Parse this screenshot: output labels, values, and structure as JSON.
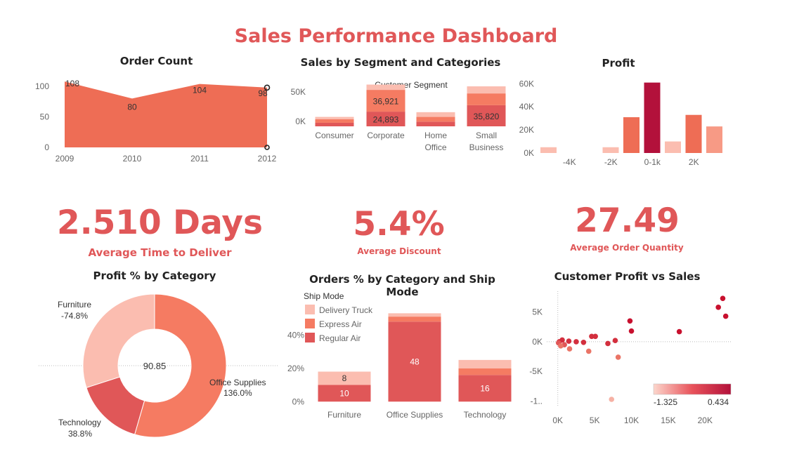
{
  "dashboard": {
    "title": "Sales Performance Dashboard",
    "colors": {
      "accent": "#e05758",
      "dark": "#b3113b",
      "medium": "#ee6d55",
      "light": "#fbbdb0"
    }
  },
  "order_count": {
    "title": "Order Count",
    "chart_data": {
      "type": "area",
      "title": "Order Count",
      "x": [
        "2009",
        "2010",
        "2011",
        "2012"
      ],
      "values": [
        108,
        80,
        104,
        98
      ],
      "yticks": [
        "100",
        "50",
        "0"
      ],
      "ylim": [
        0,
        115
      ]
    }
  },
  "segment_sales": {
    "title": "Sales by Segment and Categories",
    "axis_header": "Customer Segment",
    "chart_data": {
      "type": "bar",
      "stacked": true,
      "categories": [
        "Consumer",
        "Corporate",
        "Home Office",
        "Small Business"
      ],
      "category_lines": [
        [
          "Consumer"
        ],
        [
          "Corporate"
        ],
        [
          "Home",
          "Office"
        ],
        [
          "Small",
          "Business"
        ]
      ],
      "series": [
        {
          "values": [
            6000,
            24893,
            8000,
            35820
          ],
          "color": "#e05758"
        },
        {
          "values": [
            6000,
            36921,
            8000,
            20000
          ],
          "color": "#f57b62"
        },
        {
          "values": [
            4000,
            9000,
            8000,
            12000
          ],
          "color": "#fbbdb0"
        }
      ],
      "labels": [
        {
          "segment": 1,
          "series": 0,
          "text": "24,893"
        },
        {
          "segment": 1,
          "series": 1,
          "text": "36,921"
        },
        {
          "segment": 3,
          "series": 0,
          "text": "35,820"
        }
      ],
      "yticks": [
        "50K",
        "0K"
      ],
      "ylim": [
        0,
        80000
      ]
    }
  },
  "profit": {
    "title": "Profit",
    "chart_data": {
      "type": "bar",
      "values": [
        5000,
        0,
        0,
        5000,
        31000,
        61000,
        10000,
        33000,
        23000
      ],
      "colors": [
        "#fbbdb0",
        "#fbbdb0",
        "#fbbdb0",
        "#fbbdb0",
        "#ee6d55",
        "#b3113b",
        "#fbbdb0",
        "#ee6d55",
        "#f79a85"
      ],
      "xticks": [
        "-4K",
        "-2K",
        "0-1k",
        "2K"
      ],
      "xtick_positions": [
        1.5,
        3.5,
        5.5,
        7.5
      ],
      "yticks": [
        "60K",
        "40K",
        "20K",
        "0K"
      ],
      "ylim": [
        0,
        62000
      ]
    }
  },
  "kpis": [
    {
      "value": "2.510 Days",
      "label": "Average Time to Deliver"
    },
    {
      "value": "5.4%",
      "label": "Average Discount"
    },
    {
      "value": "27.49",
      "label": "Average Order Quantity"
    }
  ],
  "profit_category": {
    "title": "Profit % by Category",
    "center_value": "90.85",
    "chart_data": {
      "type": "pie",
      "slices": [
        {
          "label": "Office Supplies",
          "value_text": "136.0%",
          "value": 136.0,
          "color": "#f57b62"
        },
        {
          "label": "Technology",
          "value_text": "38.8%",
          "value": 38.8,
          "color": "#e05758"
        },
        {
          "label": "Furniture",
          "value_text": "-74.8%",
          "value": 74.8,
          "color": "#fbbdb0"
        }
      ]
    }
  },
  "orders_ship": {
    "title": "Orders % by Category and Ship Mode",
    "legend_title": "Ship Mode",
    "legend": [
      {
        "name": "Delivery Truck",
        "color": "#fbbdb0"
      },
      {
        "name": "Express Air",
        "color": "#f57b62"
      },
      {
        "name": "Regular Air",
        "color": "#e05758"
      }
    ],
    "chart_data": {
      "type": "bar",
      "stacked": true,
      "categories": [
        "Furniture",
        "Office Supplies",
        "Technology"
      ],
      "series": [
        {
          "name": "Regular Air",
          "values": [
            10,
            48,
            16
          ],
          "color": "#e05758",
          "labels": [
            "10",
            "48",
            "16"
          ]
        },
        {
          "name": "Express Air",
          "values": [
            0,
            3,
            4
          ],
          "color": "#f57b62",
          "labels": [
            "",
            "",
            ""
          ]
        },
        {
          "name": "Delivery Truck",
          "values": [
            8,
            2,
            5
          ],
          "color": "#fbbdb0",
          "labels": [
            "8",
            "",
            ""
          ]
        }
      ],
      "yticks": [
        "40%",
        "20%",
        "0%"
      ],
      "ytick_values": [
        40,
        20,
        0
      ],
      "ylim": [
        -2,
        62
      ]
    }
  },
  "customer_scatter": {
    "title": "Customer Profit vs Sales",
    "legend_min": "-1.325",
    "legend_max": "0.434",
    "chart_data": {
      "type": "scatter",
      "xlabel": "",
      "ylabel": "",
      "xticks": [
        "0K",
        "5K",
        "10K",
        "15K",
        "20K"
      ],
      "xtick_values": [
        0,
        5000,
        10000,
        15000,
        20000
      ],
      "yticks": [
        "5K",
        "0K",
        "-5K",
        "-1.."
      ],
      "ytick_values": [
        5000,
        0,
        -5000,
        -10000
      ],
      "xlim": [
        -1500,
        23500
      ],
      "ylim": [
        -11000,
        8500
      ],
      "points": [
        {
          "x": 22400,
          "y": 7300,
          "c": "#c8102e"
        },
        {
          "x": 21800,
          "y": 5800,
          "c": "#c8102e"
        },
        {
          "x": 22800,
          "y": 4300,
          "c": "#c8102e"
        },
        {
          "x": 9800,
          "y": 3500,
          "c": "#c8102e"
        },
        {
          "x": 10000,
          "y": 1800,
          "c": "#c8102e"
        },
        {
          "x": 16500,
          "y": 1700,
          "c": "#c8102e"
        },
        {
          "x": 4600,
          "y": 900,
          "c": "#d32f3e"
        },
        {
          "x": 5100,
          "y": 900,
          "c": "#d32f3e"
        },
        {
          "x": 7800,
          "y": 200,
          "c": "#d32f3e"
        },
        {
          "x": 6800,
          "y": -300,
          "c": "#d32f3e"
        },
        {
          "x": 3500,
          "y": -100,
          "c": "#d32f3e"
        },
        {
          "x": 2500,
          "y": 0,
          "c": "#d32f3e"
        },
        {
          "x": 1500,
          "y": 100,
          "c": "#d32f3e"
        },
        {
          "x": 600,
          "y": 300,
          "c": "#d32f3e"
        },
        {
          "x": 200,
          "y": 0,
          "c": "#d32f3e"
        },
        {
          "x": 100,
          "y": -200,
          "c": "#e05758"
        },
        {
          "x": 900,
          "y": -500,
          "c": "#e05758"
        },
        {
          "x": 400,
          "y": -700,
          "c": "#ea7466"
        },
        {
          "x": 1600,
          "y": -1200,
          "c": "#ea7466"
        },
        {
          "x": 4200,
          "y": -1600,
          "c": "#ea7466"
        },
        {
          "x": 8200,
          "y": -2600,
          "c": "#ea7466"
        },
        {
          "x": 7300,
          "y": -9700,
          "c": "#f6b1a4"
        }
      ]
    }
  }
}
